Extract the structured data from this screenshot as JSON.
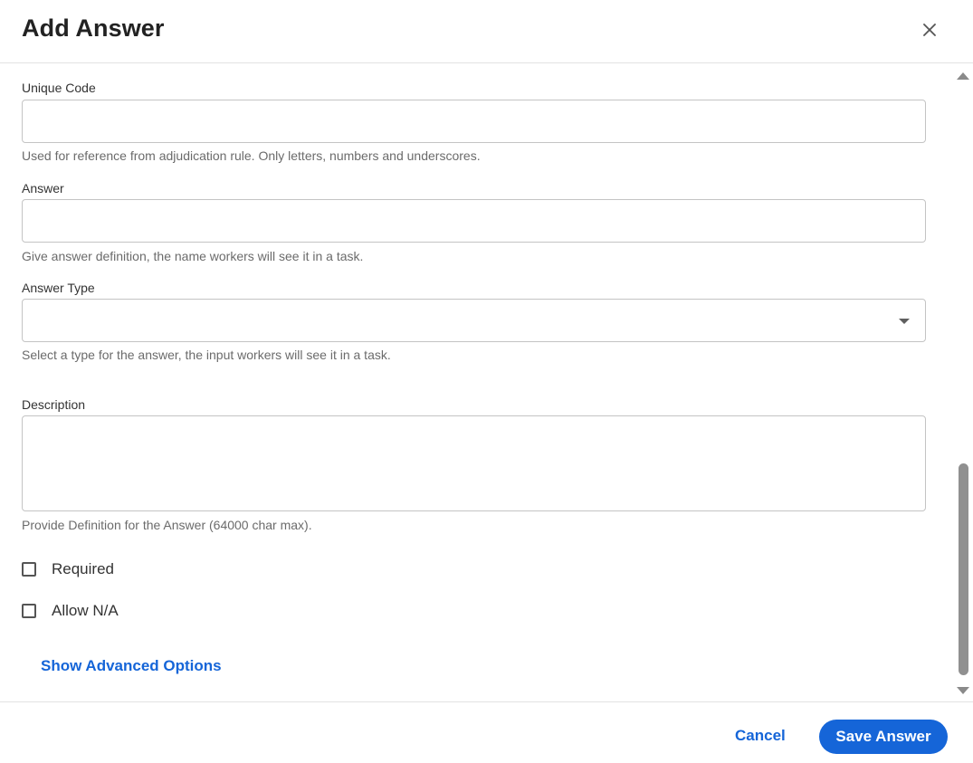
{
  "dialog": {
    "title": "Add Answer",
    "close_icon": "close-icon"
  },
  "form": {
    "unique_code": {
      "label": "Unique Code",
      "value": "",
      "helper": "Used for reference from adjudication rule. Only letters, numbers and underscores."
    },
    "answer": {
      "label": "Answer",
      "value": "",
      "helper": "Give answer definition, the name workers will see it in a task."
    },
    "answer_type": {
      "label": "Answer Type",
      "selected": "",
      "helper": "Select a type for the answer, the input workers will see it in a task.",
      "icon": "chevron-down-icon"
    },
    "description": {
      "label": "Description",
      "value": "",
      "helper": "Provide Definition for the Answer (64000 char max)."
    },
    "required": {
      "label": "Required",
      "checked": false
    },
    "allow_na": {
      "label": "Allow N/A",
      "checked": false
    },
    "advanced_link": "Show Advanced Options"
  },
  "footer": {
    "cancel_label": "Cancel",
    "save_label": "Save Answer"
  },
  "colors": {
    "accent": "#1565d8",
    "border": "#c4c4c4",
    "helper_text": "#6b6b6b"
  }
}
